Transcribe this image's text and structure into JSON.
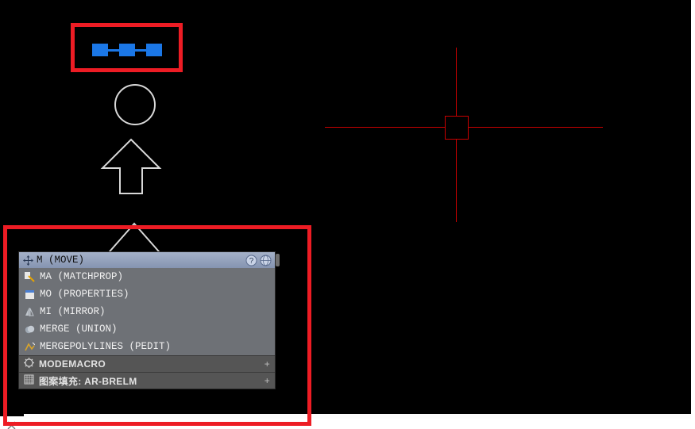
{
  "linetype_preview": {
    "name": "dash-square-linetype"
  },
  "cursor": {
    "color": "#c80000"
  },
  "autocomplete": {
    "header": "M (MOVE)",
    "items": [
      {
        "label": "MA (MATCHPROP)",
        "icon": "matchprop-icon"
      },
      {
        "label": "MO (PROPERTIES)",
        "icon": "properties-icon"
      },
      {
        "label": "MI (MIRROR)",
        "icon": "mirror-icon"
      },
      {
        "label": "MERGE (UNION)",
        "icon": "union-icon"
      },
      {
        "label": "MERGEPOLYLINES (PEDIT)",
        "icon": "pedit-icon"
      }
    ],
    "sysvars": [
      {
        "label": "MODEMACRO",
        "icon": "gear-icon"
      },
      {
        "label": "图案填充: AR-BRELM",
        "icon": "hatch-icon"
      }
    ]
  }
}
